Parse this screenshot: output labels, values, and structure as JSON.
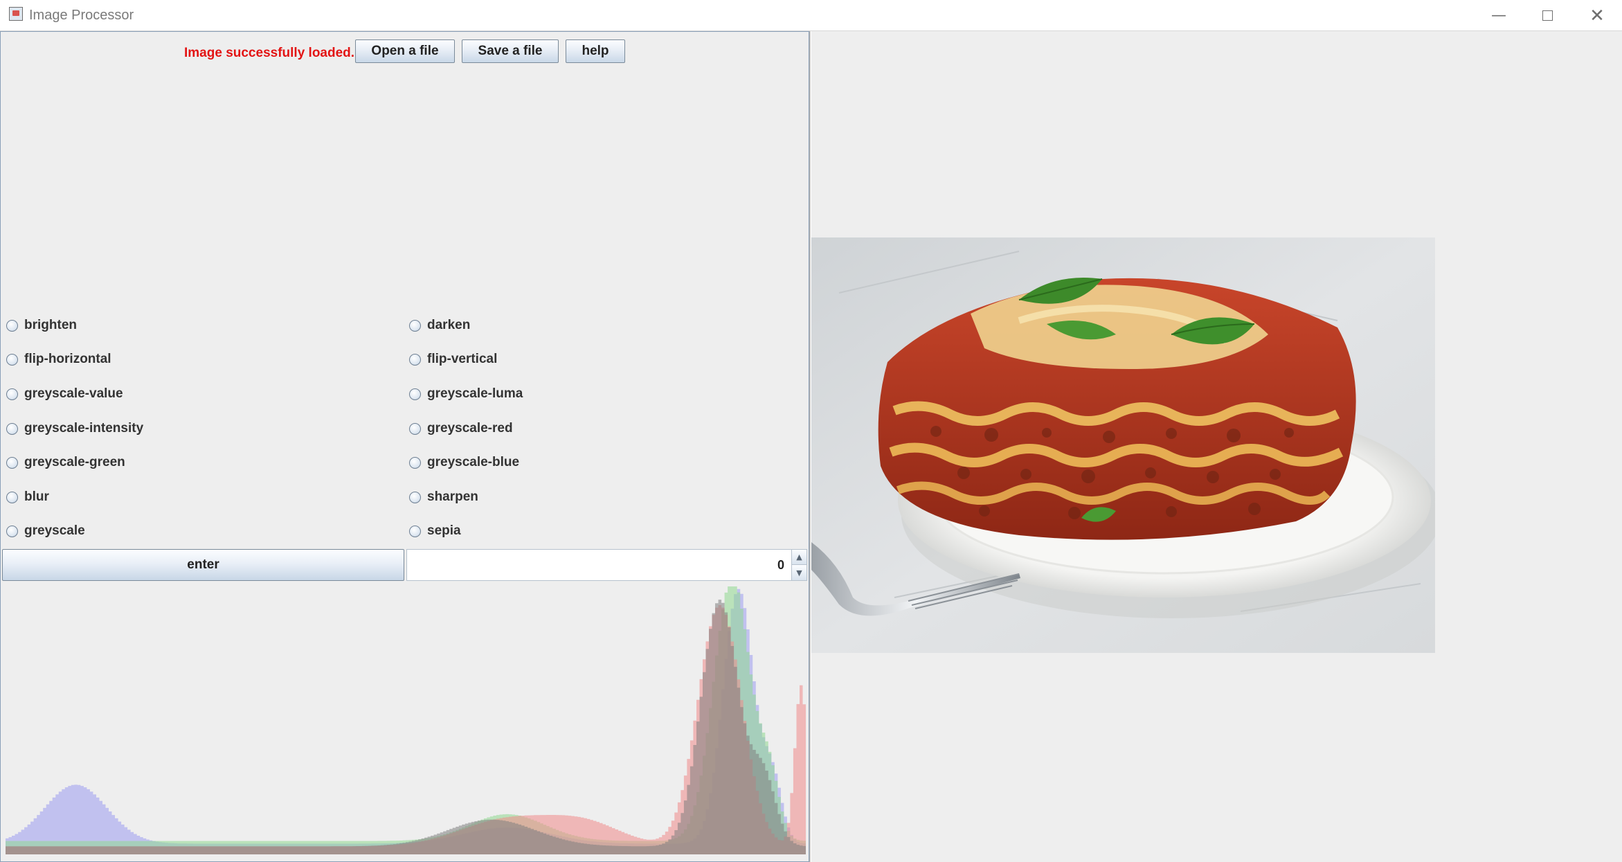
{
  "window": {
    "title": "Image Processor",
    "min_icon": "minimize-icon",
    "max_icon": "maximize-icon",
    "close_icon": "close-icon"
  },
  "toolbar": {
    "status": "Image successfully loaded.",
    "status_color": "#e31414",
    "open_label": "Open a file",
    "save_label": "Save a file",
    "help_label": "help"
  },
  "operations": {
    "left": [
      "brighten",
      "flip-horizontal",
      "greyscale-value",
      "greyscale-intensity",
      "greyscale-green",
      "blur",
      "greyscale"
    ],
    "right": [
      "darken",
      "flip-vertical",
      "greyscale-luma",
      "greyscale-red",
      "greyscale-blue",
      "sharpen",
      "sepia"
    ]
  },
  "controls": {
    "enter_label": "enter",
    "spinner_value": "0"
  },
  "histogram": {
    "series_colors": {
      "red": "#f08a8a",
      "green": "#8fd88f",
      "blue": "#9c9cf0",
      "intensity": "#7f7f7f"
    }
  },
  "image": {
    "subject": "lasagna on a white plate with a fork"
  }
}
